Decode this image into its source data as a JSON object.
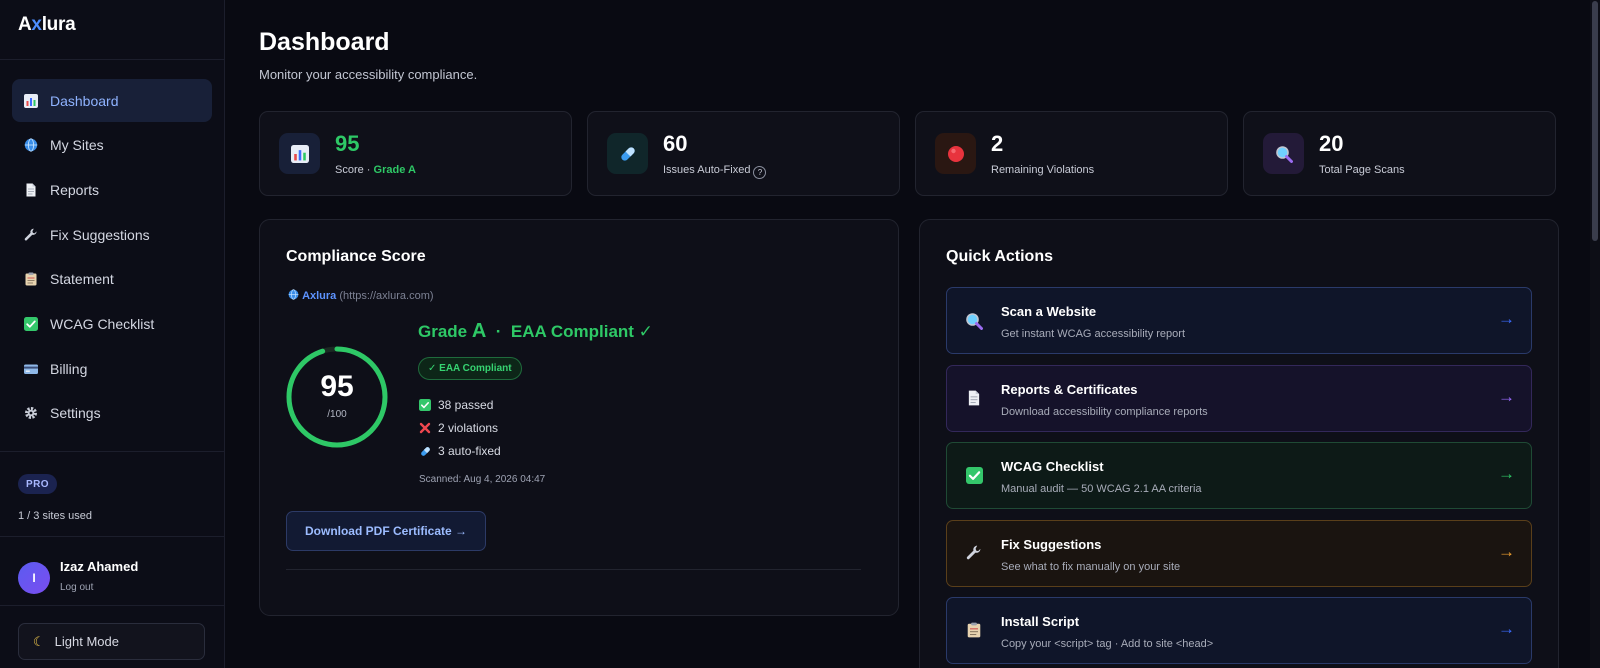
{
  "app": {
    "logo_prefix": "A",
    "logo_x": "x",
    "logo_suffix": "lura"
  },
  "sidebar": {
    "items": [
      {
        "label": "Dashboard",
        "icon": "bar-chart-icon"
      },
      {
        "label": "My Sites",
        "icon": "globe-icon"
      },
      {
        "label": "Reports",
        "icon": "document-icon"
      },
      {
        "label": "Fix Suggestions",
        "icon": "wrench-icon"
      },
      {
        "label": "Statement",
        "icon": "clipboard-icon"
      },
      {
        "label": "WCAG Checklist",
        "icon": "check-box-icon"
      },
      {
        "label": "Billing",
        "icon": "credit-card-icon"
      },
      {
        "label": "Settings",
        "icon": "gear-icon"
      }
    ],
    "plan_badge": "PRO",
    "sites_used": "1 / 3 sites used",
    "user": {
      "initial": "I",
      "name": "Izaz Ahamed",
      "logout": "Log out"
    },
    "light_mode_label": "Light Mode"
  },
  "header": {
    "title": "Dashboard",
    "subtitle": "Monitor your accessibility compliance."
  },
  "stats": [
    {
      "value": "95",
      "label": "Score · ",
      "grade": "Grade A",
      "icon": "bar-chart-icon",
      "value_color": "#2ec866"
    },
    {
      "value": "60",
      "label": "Issues Auto-Fixed",
      "help": "?",
      "icon": "pill-icon",
      "value_color": "#ffffff"
    },
    {
      "value": "2",
      "label": "Remaining Violations",
      "icon": "red-circle-icon",
      "value_color": "#ffffff"
    },
    {
      "value": "20",
      "label": "Total Page Scans",
      "icon": "magnifier-icon",
      "value_color": "#ffffff"
    }
  ],
  "compliance": {
    "title": "Compliance Score",
    "site_name": "Axlura",
    "site_url": "(https://axlura.com)",
    "score": "95",
    "score_max": "/100",
    "score_fraction": 0.95,
    "grade_prefix": "Grade ",
    "grade_letter": "A",
    "grade_suffix": "  ·  EAA Compliant ✓",
    "badge": "✓ EAA Compliant",
    "passed": "38 passed",
    "violations": "2 violations",
    "auto_fixed": "3 auto-fixed",
    "scanned": "Scanned: Aug 4, 2026 04:47",
    "download_label": "Download PDF Certificate →"
  },
  "quick_actions": {
    "title": "Quick Actions",
    "items": [
      {
        "title": "Scan a Website",
        "desc": "Get instant WCAG accessibility report",
        "icon": "magnifier-icon",
        "accent": "#3b6cff",
        "bg": "#0f1529",
        "border": "#2a3a6a"
      },
      {
        "title": "Reports & Certificates",
        "desc": "Download accessibility compliance reports",
        "icon": "document-icon",
        "accent": "#9b6cff",
        "bg": "#15122a",
        "border": "#33285a"
      },
      {
        "title": "WCAG Checklist",
        "desc": "Manual audit — 50 WCAG 2.1 AA criteria",
        "icon": "check-box-icon",
        "accent": "#2ec866",
        "bg": "#0d1a17",
        "border": "#1f4a35"
      },
      {
        "title": "Fix Suggestions",
        "desc": "See what to fix manually on your site",
        "icon": "wrench-icon",
        "accent": "#f0a030",
        "bg": "#1a1410",
        "border": "#5a3f1a"
      },
      {
        "title": "Install Script",
        "desc": "Copy your <script> tag · Add to site <head>",
        "icon": "clipboard-icon",
        "accent": "#3b6cff",
        "bg": "#0f1529",
        "border": "#2a3a6a"
      }
    ],
    "arrow": "→"
  }
}
